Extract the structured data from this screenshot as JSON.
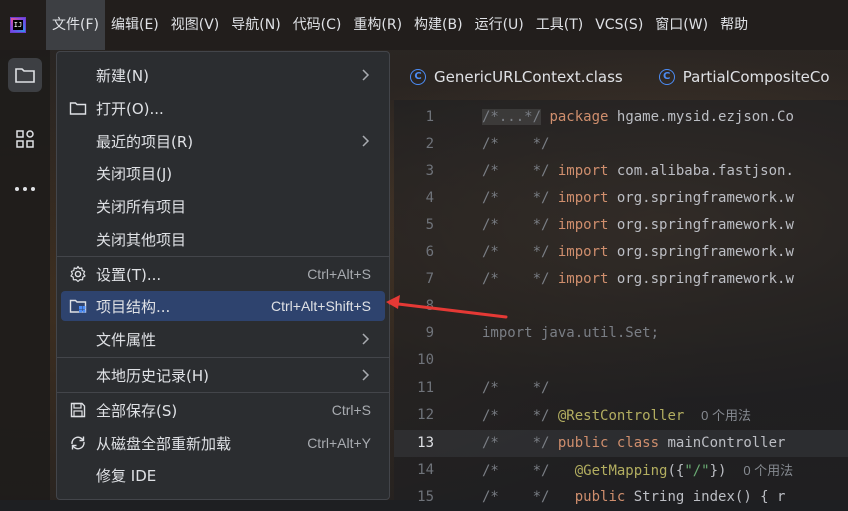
{
  "menubar": {
    "items": [
      "文件(F)",
      "编辑(E)",
      "视图(V)",
      "导航(N)",
      "代码(C)",
      "重构(R)",
      "构建(B)",
      "运行(U)",
      "工具(T)",
      "VCS(S)",
      "窗口(W)",
      "帮助"
    ]
  },
  "tabs": [
    {
      "label": "GenericURLContext.class",
      "icon": "C"
    },
    {
      "label": "PartialCompositeCo",
      "icon": "C"
    }
  ],
  "file_menu": {
    "items": [
      {
        "label": "新建(N)",
        "shortcut": "",
        "submenu": true
      },
      {
        "label": "打开(O)...",
        "shortcut": "",
        "icon": "folder-icon"
      },
      {
        "label": "最近的项目(R)",
        "shortcut": "",
        "submenu": true
      },
      {
        "label": "关闭项目(J)",
        "shortcut": ""
      },
      {
        "label": "关闭所有项目",
        "shortcut": ""
      },
      {
        "label": "关闭其他项目",
        "shortcut": ""
      },
      {
        "label": "设置(T)...",
        "shortcut": "Ctrl+Alt+S",
        "icon": "gear-icon"
      },
      {
        "label": "项目结构...",
        "shortcut": "Ctrl+Alt+Shift+S",
        "icon": "project-structure-icon",
        "highlighted": true
      },
      {
        "label": "文件属性",
        "shortcut": "",
        "submenu": true
      },
      {
        "label": "本地历史记录(H)",
        "shortcut": "",
        "submenu": true
      },
      {
        "label": "全部保存(S)",
        "shortcut": "Ctrl+S",
        "icon": "save-icon"
      },
      {
        "label": "从磁盘全部重新加载",
        "shortcut": "Ctrl+Alt+Y",
        "icon": "reload-icon"
      },
      {
        "label": "修复 IDE",
        "shortcut": ""
      }
    ]
  },
  "editor": {
    "line_numbers": [
      "1",
      "2",
      "3",
      "4",
      "5",
      "6",
      "7",
      "8",
      "9",
      "10",
      "11",
      "12",
      "13",
      "14",
      "15"
    ],
    "current_line": "13",
    "lines": {
      "l1_c": "/*...*/",
      "l1_kw": "package",
      "l1_rest": " hgame.mysid.ezjson.Co",
      "l2": "/*    */",
      "l3_c": "/*    */",
      "l3_kw": "import",
      "l3_rest": " com.alibaba.fastjson.",
      "l4_c": "/*    */",
      "l4_kw": "import",
      "l4_rest": " org.springframework.w",
      "l5_c": "/*    */",
      "l5_kw": "import",
      "l5_rest": " org.springframework.w",
      "l6_c": "/*    */",
      "l6_kw": "import",
      "l6_rest": " org.springframework.w",
      "l7_c": "/*    */",
      "l7_kw": "import",
      "l7_rest": " org.springframework.w",
      "l9": "import java.util.Set;",
      "l11": "/*    */",
      "l12_c": "/*    */",
      "l12_an": "@RestController",
      "l12_hint": "0 个用法",
      "l13_c": "/*    */",
      "l13_kw": "public class",
      "l13_rest": " mainController",
      "l14_c": "/*    */",
      "l14_an": "@GetMapping",
      "l14_p1": "({",
      "l14_st": "\"/\"",
      "l14_p2": "})",
      "l14_hint": "0 个用法",
      "l15_c": "/*    */",
      "l15_kw": "public",
      "l15_rest": " String index() { r"
    }
  }
}
